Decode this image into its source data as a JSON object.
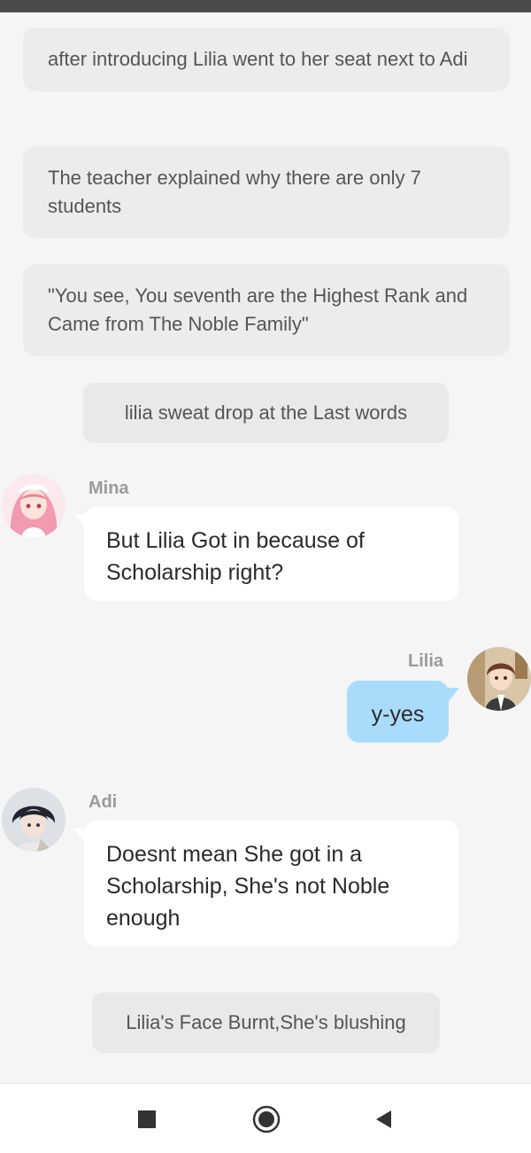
{
  "narration": [
    "after introducing Lilia went to her seat next to Adi",
    "The teacher explained why there are only 7 students",
    "\"You see, You seventh are the Highest Rank and Came from The Noble Family\""
  ],
  "notes": [
    "lilia sweat drop at the  Last words",
    "Lilia's Face Burnt,She's blushing"
  ],
  "messages": [
    {
      "speaker": "Mina",
      "text": "But Lilia Got in because of Scholarship right?",
      "side": "left"
    },
    {
      "speaker": "Lilia",
      "text": "y-yes",
      "side": "right"
    },
    {
      "speaker": "Adi",
      "text": "Doesnt mean She got in a Scholarship, She's not Noble enough",
      "side": "left"
    }
  ],
  "navbar": {
    "icons": [
      "stop-square-icon",
      "home-circle-icon",
      "back-triangle-icon"
    ]
  },
  "colors": {
    "background": "#f5f5f5",
    "narration_bg": "#ececec",
    "bubble_left": "#ffffff",
    "bubble_right": "#a9dcfb",
    "speaker_name": "#9a9a9a"
  }
}
